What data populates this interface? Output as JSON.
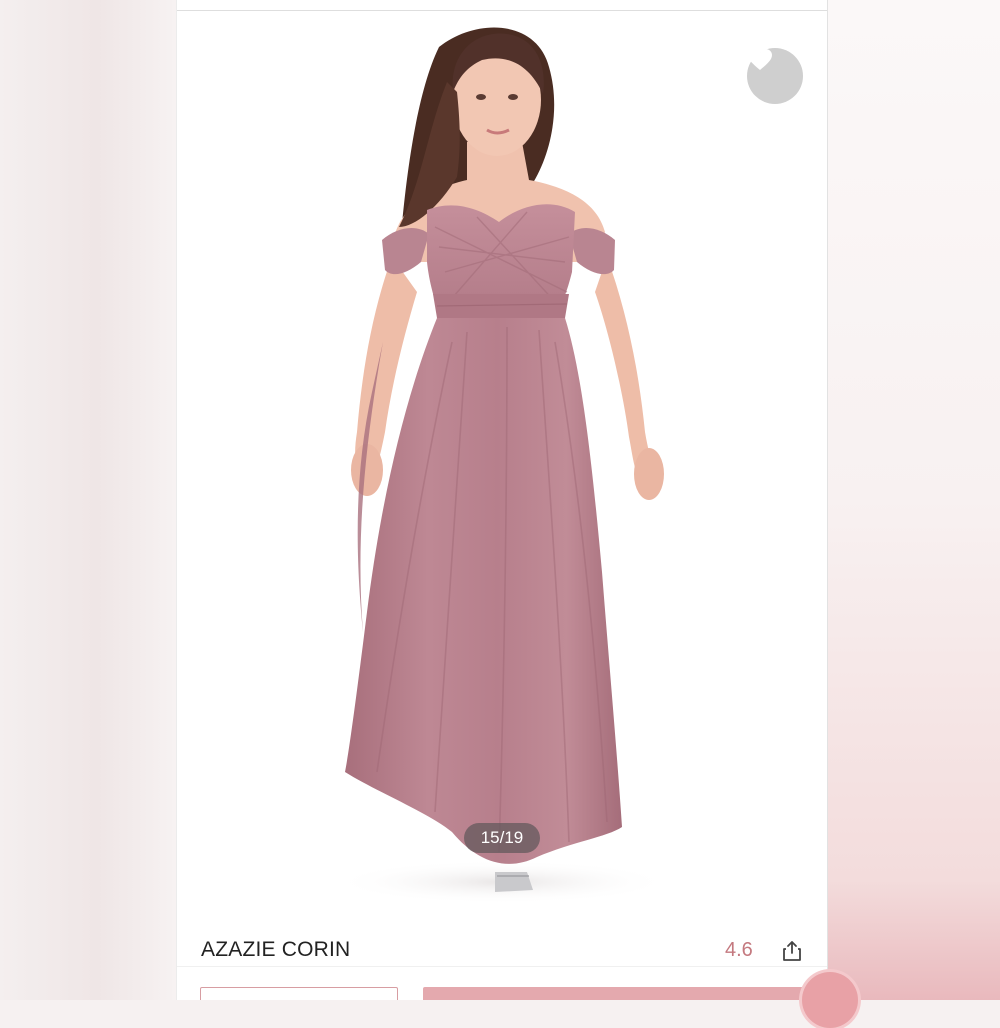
{
  "product": {
    "name": "AZAZIE CORIN",
    "rating": "4.6"
  },
  "gallery": {
    "counter": "15/19"
  },
  "icons": {
    "favorite": "heart-icon",
    "share": "share-icon"
  },
  "colors": {
    "accent": "#c4797f",
    "dress": "#b8818d",
    "button": "#e4a9ae"
  }
}
